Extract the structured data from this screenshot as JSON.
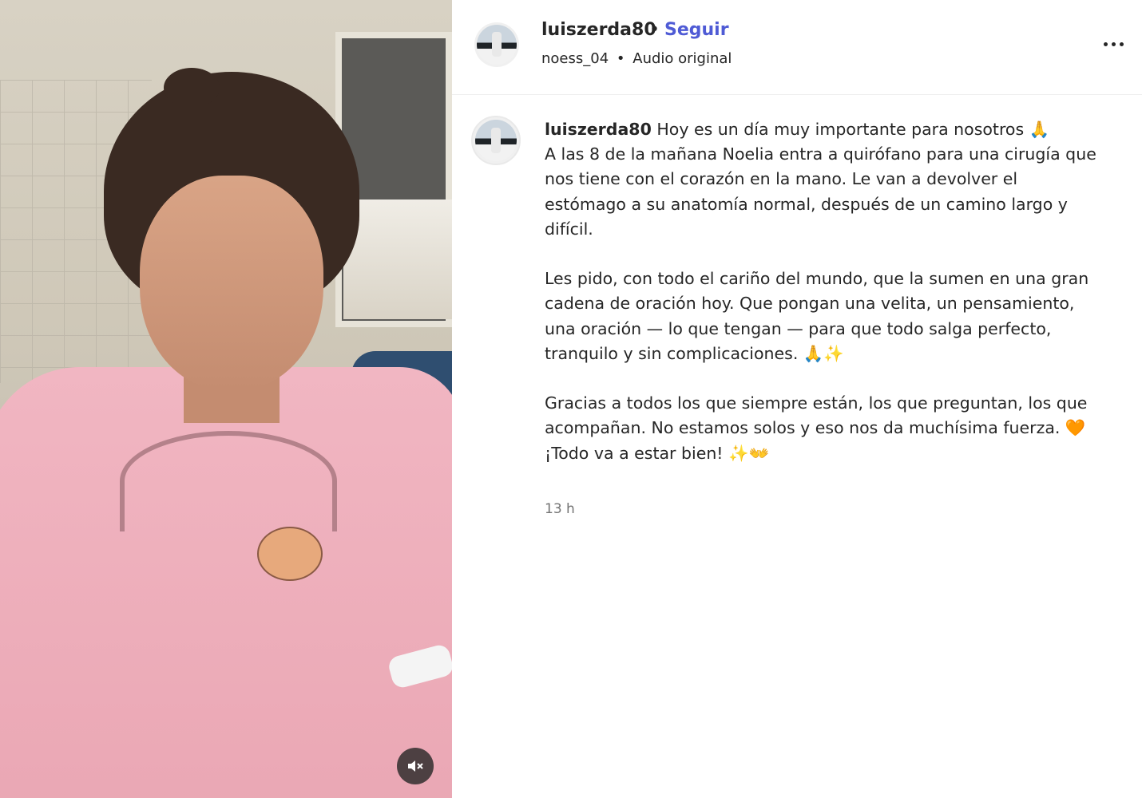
{
  "header": {
    "username": "luiszerda80",
    "separator": "•",
    "follow_label": "Seguir",
    "audio_user": "noess_04",
    "audio_separator": "•",
    "audio_label": "Audio original"
  },
  "caption": {
    "username": "luiszerda80",
    "text": " Hoy es un día muy importante para nosotros 🙏\nA las 8 de la mañana Noelia entra a quirófano para una cirugía que nos tiene con el corazón en la mano. Le van a devolver el estómago a su anatomía normal, después de un camino largo y difícil.\n\nLes pido, con todo el cariño del mundo, que la sumen en una gran cadena de oración hoy. Que pongan una velita, un pensamiento, una oración — lo que tengan — para que todo salga perfecto, tranquilo y sin complicaciones. 🙏✨\n\nGracias a todos los que siempre están, los que preguntan, los que acompañan. No estamos solos y eso nos da muchísima fuerza. 🧡\n¡Todo va a estar bien! ✨👐",
    "timestamp": "13 h"
  },
  "icons": {
    "more": "more-options-icon",
    "mute": "speaker-muted-icon"
  }
}
